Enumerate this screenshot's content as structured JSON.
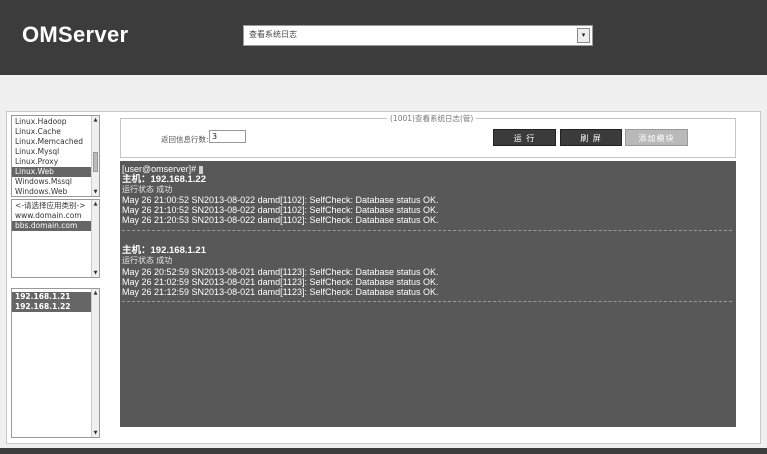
{
  "app": {
    "title": "OMServer"
  },
  "task_select": {
    "value": "查看系统日志",
    "arrow": "▾"
  },
  "app_list": {
    "items": [
      "Linux.Hadoop",
      "Linux.Cache",
      "Linux.Memcached",
      "Linux.Mysql",
      "Linux.Proxy",
      "Linux.Web",
      "Windows.Mssql",
      "Windows.Web"
    ],
    "selected_index": 5
  },
  "domain_list": {
    "items": [
      "<-请选择应用类别->",
      "www.domain.com",
      "bbs.domain.com"
    ],
    "selected_index": 2
  },
  "host_list": {
    "items": [
      "192.168.1.21",
      "192.168.1.22"
    ],
    "selected": [
      "192.168.1.21",
      "192.168.1.22"
    ]
  },
  "panel": {
    "legend": "(1001)查看系统日志(管)",
    "lines_label": "返回信息行数:",
    "lines_value": "3",
    "run_label": "运 行",
    "refresh_label": "刷 屏",
    "add_label": "添加模块"
  },
  "console": {
    "prompt": "[user@omserver]#",
    "blocks": [
      {
        "host_label": "主机：",
        "host": "192.168.1.22",
        "status": "运行状态 成功",
        "lines": [
          "May 26 21:00:52 SN2013-08-022 damd[1102]: SelfCheck: Database status OK.",
          "May 26 21:10:52 SN2013-08-022 damd[1102]: SelfCheck: Database status OK.",
          "May 26 21:20:53 SN2013-08-022 damd[1102]: SelfCheck: Database status OK."
        ]
      },
      {
        "host_label": "主机：",
        "host": "192.168.1.21",
        "status": "运行状态 成功",
        "lines": [
          "May 26 20:52:59 SN2013-08-021 damd[1123]: SelfCheck: Database status OK.",
          "May 26 21:02:59 SN2013-08-021 damd[1123]: SelfCheck: Database status OK.",
          "May 26 21:12:59 SN2013-08-021 damd[1123]: SelfCheck: Database status OK."
        ]
      }
    ]
  },
  "colors": {
    "header": "#3c3c3c",
    "console_bg": "#585858",
    "selected": "#666666"
  }
}
